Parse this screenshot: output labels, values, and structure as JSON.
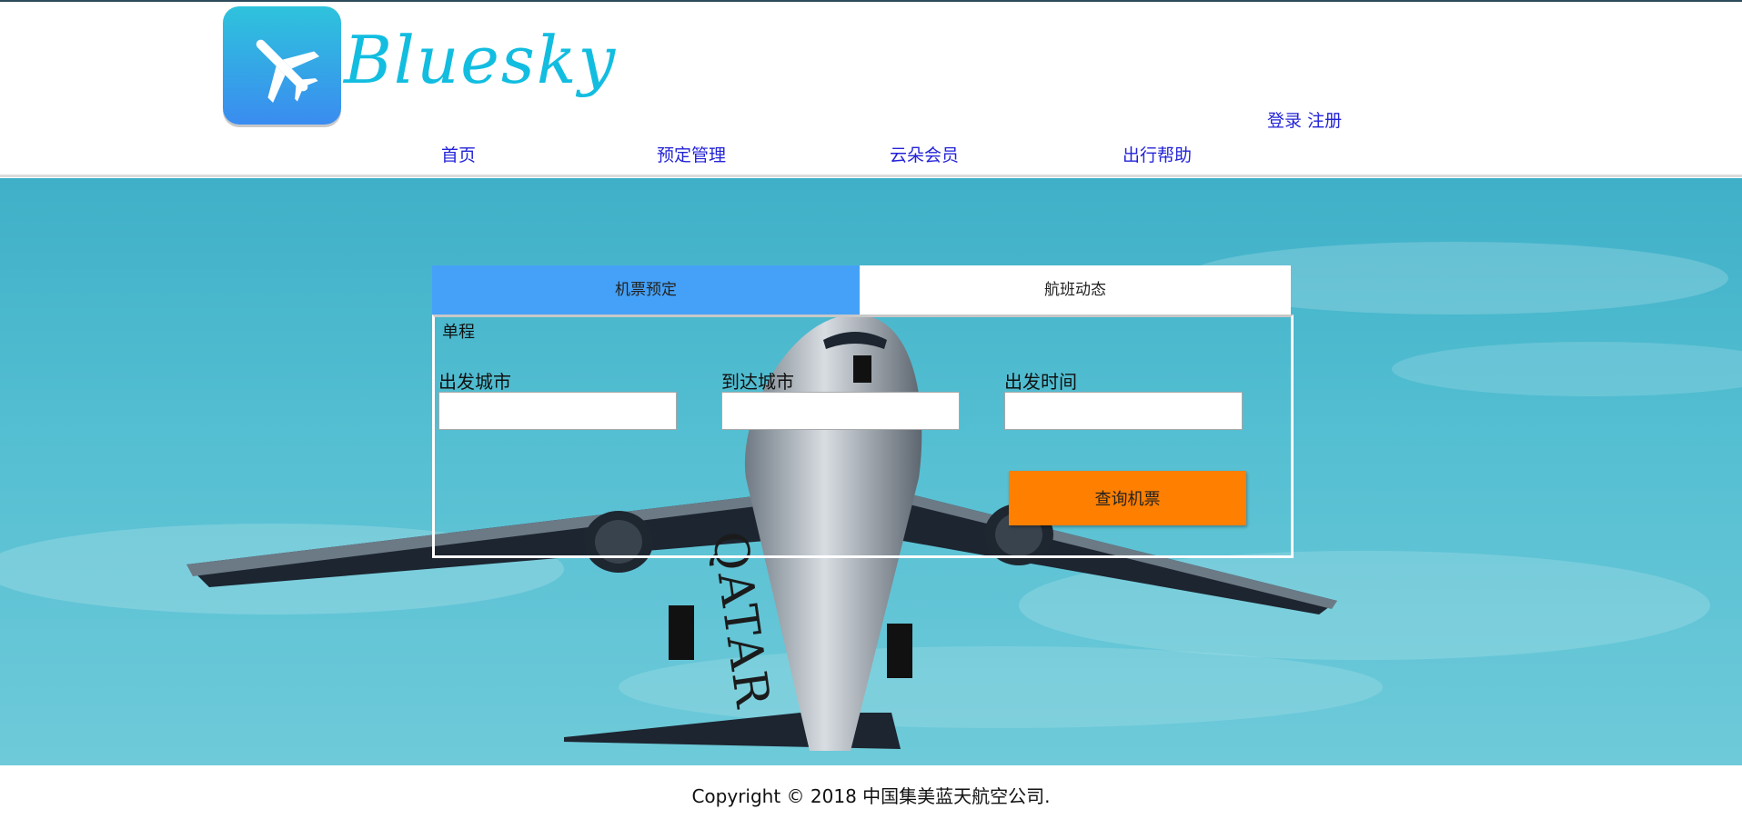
{
  "brand": {
    "name": "Bluesky",
    "logo_icon": "airplane-icon",
    "accent": "#12bde0"
  },
  "auth": {
    "login": "登录",
    "register": "注册"
  },
  "nav": {
    "items": [
      "首页",
      "预定管理",
      "云朵会员",
      "出行帮助"
    ]
  },
  "tabs": [
    {
      "label": "机票预定",
      "active": true
    },
    {
      "label": "航班动态",
      "active": false
    }
  ],
  "search_form": {
    "trip_type": "单程",
    "departure_label": "出发城市",
    "departure_value": "",
    "arrival_label": "到达城市",
    "arrival_value": "",
    "date_label": "出发时间",
    "date_value": "",
    "submit_label": "查询机票"
  },
  "hero": {
    "image": "airplane-photo",
    "livery_text": "QATAR"
  },
  "footer": {
    "copyright": "Copyright © 2018 中国集美蓝天航空公司."
  },
  "colors": {
    "link": "#2323d8",
    "tab_active": "#45a1f7",
    "button": "#ff7f00",
    "sky": "#4fb8cc"
  }
}
